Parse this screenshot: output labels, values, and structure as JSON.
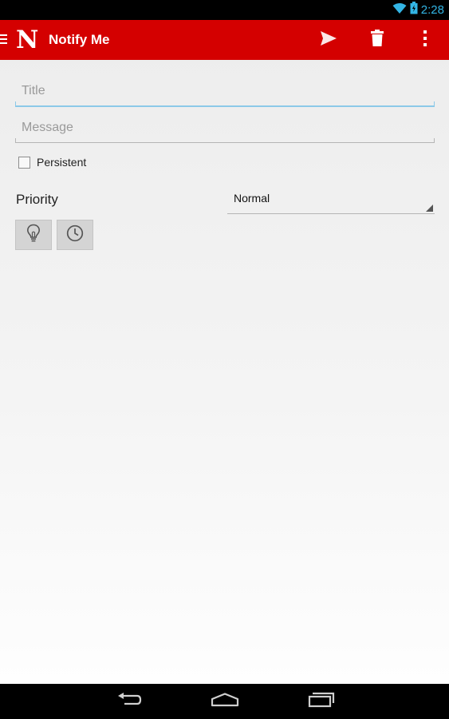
{
  "status_bar": {
    "time": "2:28",
    "icons": [
      "wifi-icon",
      "battery-icon"
    ],
    "accent_color": "#33b5e5"
  },
  "action_bar": {
    "title": "Notify Me",
    "logo": "N",
    "color": "#d40000",
    "actions": [
      "send-icon",
      "trash-icon",
      "overflow-menu-icon"
    ]
  },
  "form": {
    "title_placeholder": "Title",
    "title_value": "",
    "message_placeholder": "Message",
    "message_value": "",
    "persistent_label": "Persistent",
    "persistent_checked": false,
    "priority_label": "Priority",
    "priority_value": "Normal",
    "icon_buttons": [
      "lightbulb-icon",
      "clock-icon"
    ]
  },
  "nav_bar": {
    "buttons": [
      "back-icon",
      "home-icon",
      "recent-apps-icon"
    ]
  }
}
